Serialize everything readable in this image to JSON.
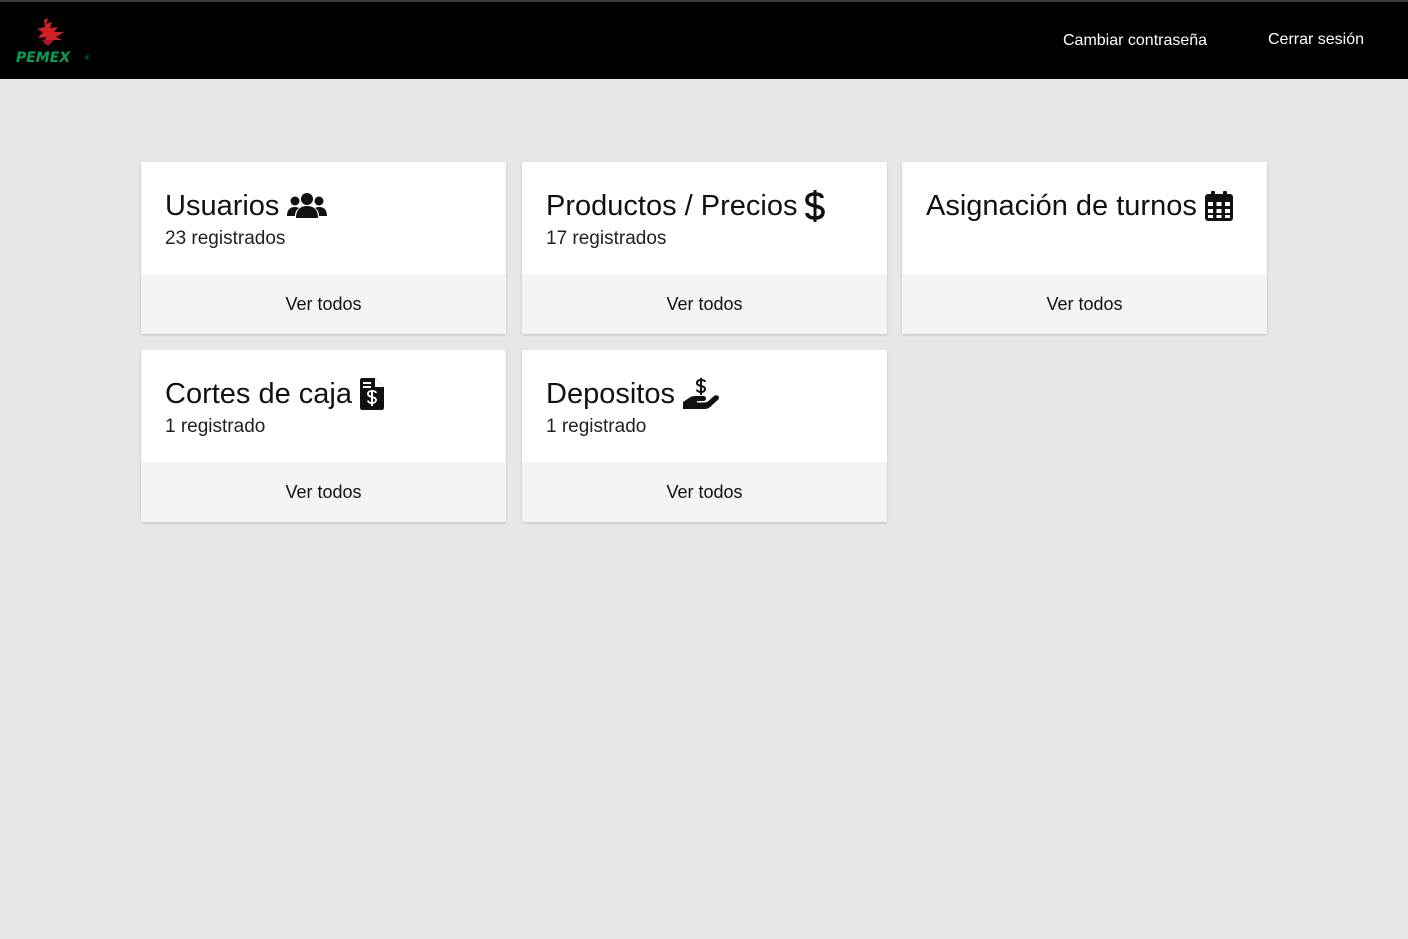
{
  "header": {
    "logo_text": "PEMEX",
    "change_password": "Cambiar contraseña",
    "logout": "Cerrar sesión"
  },
  "cards": [
    {
      "title": "Usuarios",
      "count": "23 registrados",
      "action": "Ver todos",
      "icon": "users-icon"
    },
    {
      "title": "Productos / Precios",
      "count": "17 registrados",
      "action": "Ver todos",
      "icon": "dollar-icon"
    },
    {
      "title": "Asignación de turnos",
      "count": "",
      "action": "Ver todos",
      "icon": "calendar-icon"
    },
    {
      "title": "Cortes de caja",
      "count": "1 registrado",
      "action": "Ver todos",
      "icon": "invoice-dollar-icon"
    },
    {
      "title": "Depositos",
      "count": "1 registrado",
      "action": "Ver todos",
      "icon": "hand-holding-dollar-icon"
    }
  ],
  "colors": {
    "topbar": "#000000",
    "background": "#e5e7eb",
    "card_footer": "#f3f4f6",
    "logo_red": "#d22027",
    "logo_green": "#00a05a"
  }
}
